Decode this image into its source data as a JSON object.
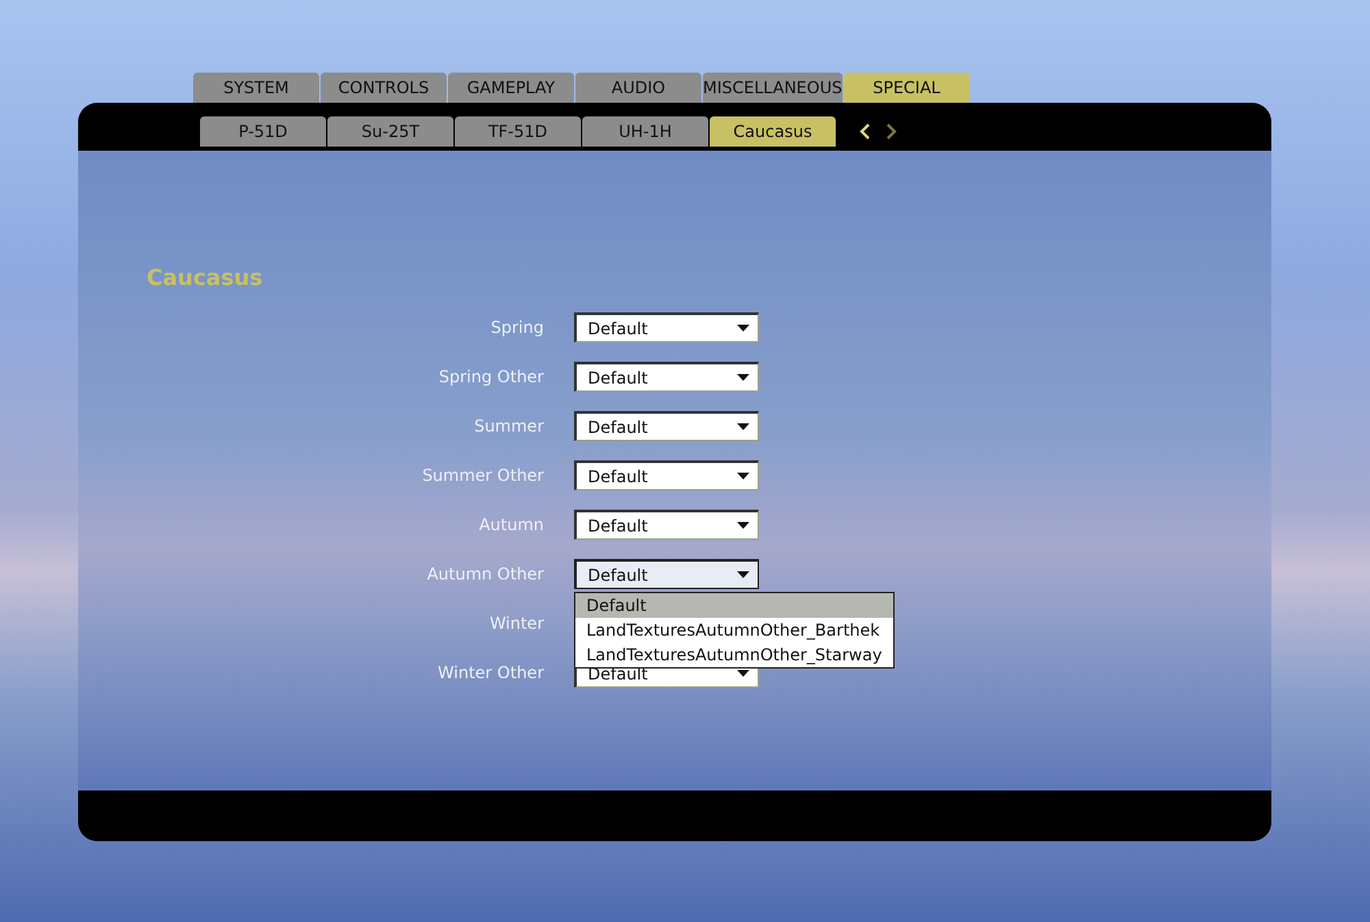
{
  "main_tabs": [
    {
      "label": "SYSTEM",
      "selected": false
    },
    {
      "label": "CONTROLS",
      "selected": false
    },
    {
      "label": "GAMEPLAY",
      "selected": false
    },
    {
      "label": "AUDIO",
      "selected": false
    },
    {
      "label": "MISCELLANEOUS",
      "selected": false
    },
    {
      "label": "SPECIAL",
      "selected": true
    }
  ],
  "sub_tabs": [
    {
      "label": "P-51D",
      "selected": false
    },
    {
      "label": "Su-25T",
      "selected": false
    },
    {
      "label": "TF-51D",
      "selected": false
    },
    {
      "label": "UH-1H",
      "selected": false
    },
    {
      "label": "Caucasus",
      "selected": true
    }
  ],
  "tab_scroll": {
    "previous_enabled": true,
    "next_enabled": false
  },
  "section_title": "Caucasus",
  "settings": [
    {
      "label": "Spring",
      "value": "Default",
      "expanded": false
    },
    {
      "label": "Spring Other",
      "value": "Default",
      "expanded": false
    },
    {
      "label": "Summer",
      "value": "Default",
      "expanded": false
    },
    {
      "label": "Summer Other",
      "value": "Default",
      "expanded": false
    },
    {
      "label": "Autumn",
      "value": "Default",
      "expanded": false
    },
    {
      "label": "Autumn Other",
      "value": "Default",
      "expanded": true,
      "options": [
        {
          "label": "Default",
          "selected": true
        },
        {
          "label": "LandTexturesAutumnOther_Barthek",
          "selected": false
        },
        {
          "label": "LandTexturesAutumnOther_Starway",
          "selected": false
        }
      ]
    },
    {
      "label": "Winter",
      "expanded": false
    },
    {
      "label": "Winter Other",
      "value": "Default",
      "expanded": false
    }
  ]
}
